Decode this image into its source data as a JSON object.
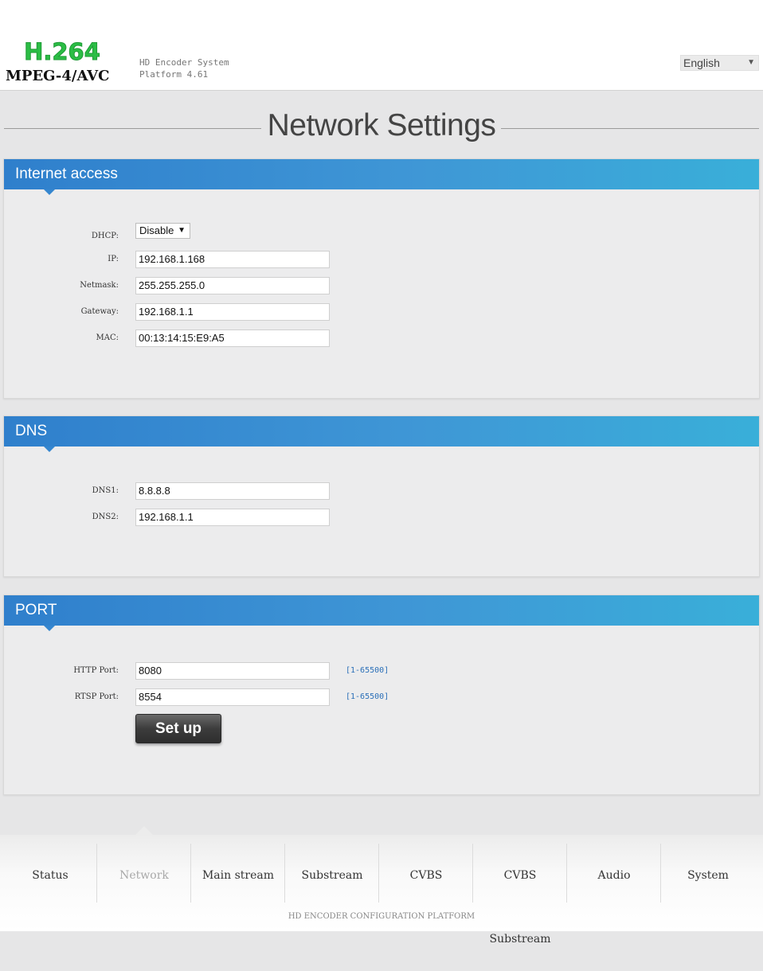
{
  "header": {
    "logo_top": "H.264",
    "logo_bottom": "MPEG-4/AVC",
    "system_name": "HD Encoder System",
    "platform_version": "Platform 4.61",
    "language": {
      "selected": "English",
      "arrow": "▼"
    }
  },
  "page": {
    "title": "Network Settings"
  },
  "internet_access": {
    "title": "Internet access",
    "dhcp": {
      "label": "DHCP:",
      "value": "Disable",
      "arrow": "▼"
    },
    "ip": {
      "label": "IP:",
      "value": "192.168.1.168"
    },
    "netmask": {
      "label": "Netmask:",
      "value": "255.255.255.0"
    },
    "gateway": {
      "label": "Gateway:",
      "value": "192.168.1.1"
    },
    "mac": {
      "label": "MAC:",
      "value": "00:13:14:15:E9:A5"
    }
  },
  "dns": {
    "title": "DNS",
    "dns1": {
      "label": "DNS1:",
      "value": "8.8.8.8"
    },
    "dns2": {
      "label": "DNS2:",
      "value": "192.168.1.1"
    }
  },
  "port": {
    "title": "PORT",
    "http": {
      "label": "HTTP Port:",
      "value": "8080",
      "range": "[1-65500]"
    },
    "rtsp": {
      "label": "RTSP Port:",
      "value": "8554",
      "range": "[1-65500]"
    },
    "setup_label": "Set up"
  },
  "nav": {
    "active": "Network",
    "items": [
      "Status",
      "Network",
      "Main stream",
      "Substream",
      "CVBS",
      "CVBS Substream",
      "Audio",
      "System"
    ]
  },
  "footer": {
    "text": "HD ENCODER CONFIGURATION PLATFORM"
  },
  "colors": {
    "panel_header_start": "#2f7fcc",
    "panel_header_end": "#39afd9",
    "logo_green": "#2bbd45",
    "hint_blue": "#2a6fb8"
  }
}
